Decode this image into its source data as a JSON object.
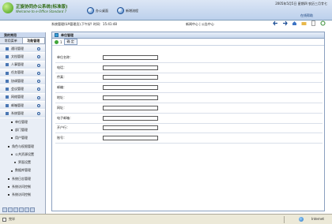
{
  "header": {
    "brand": "正旋协同办公系统(标准版)",
    "brand_sub": "Welcome to e-Office Standard 7",
    "nav": [
      "办公桌面",
      "新增流程"
    ],
    "date_info": "2005年5月5日 星期四 农历三月廿七",
    "help": "在线帮助"
  },
  "sidebar": {
    "title": "我的常用",
    "tabs": [
      "常用菜单",
      "功能管理"
    ],
    "items": [
      {
        "label": "通讯管理",
        "type": "menu"
      },
      {
        "label": "文档管理",
        "type": "menu"
      },
      {
        "label": "人事管理",
        "type": "menu"
      },
      {
        "label": "任务管理",
        "type": "menu"
      },
      {
        "label": "协调管理",
        "type": "menu"
      },
      {
        "label": "会议管理",
        "type": "menu"
      },
      {
        "label": "网络管理",
        "type": "menu"
      },
      {
        "label": "邮箱管理",
        "type": "menu"
      },
      {
        "label": "系统管理",
        "type": "menu"
      },
      {
        "label": "单位管理",
        "type": "sub"
      },
      {
        "label": "部门管理",
        "type": "sub"
      },
      {
        "label": "用户管理",
        "type": "sub"
      },
      {
        "label": "角色与权限管理",
        "type": "sub2"
      },
      {
        "label": "公共资源设置",
        "type": "sub3"
      },
      {
        "label": "界面设置",
        "type": "sub3"
      },
      {
        "label": "数据库管理",
        "type": "sub3"
      },
      {
        "label": "系统日志管理",
        "type": "sub2"
      },
      {
        "label": "系统访问控制",
        "type": "sub2"
      },
      {
        "label": "系统访问控制",
        "type": "sub2"
      }
    ]
  },
  "content": {
    "breadcrumb": "系统管理(UA管理员),下午好! 时间：15:41:48",
    "links": "新闻中心 | 公告中心",
    "panel_title": "单位管理",
    "ok_label": "确  定",
    "fields": [
      {
        "label": "单位名称："
      },
      {
        "label": "电话："
      },
      {
        "label": "传真："
      },
      {
        "label": "邮编："
      },
      {
        "label": "地址："
      },
      {
        "label": "网址："
      },
      {
        "label": "电子邮箱："
      },
      {
        "label": "开户行："
      },
      {
        "label": "账号："
      }
    ]
  },
  "status": {
    "text": "完毕",
    "zone": "Internet"
  }
}
